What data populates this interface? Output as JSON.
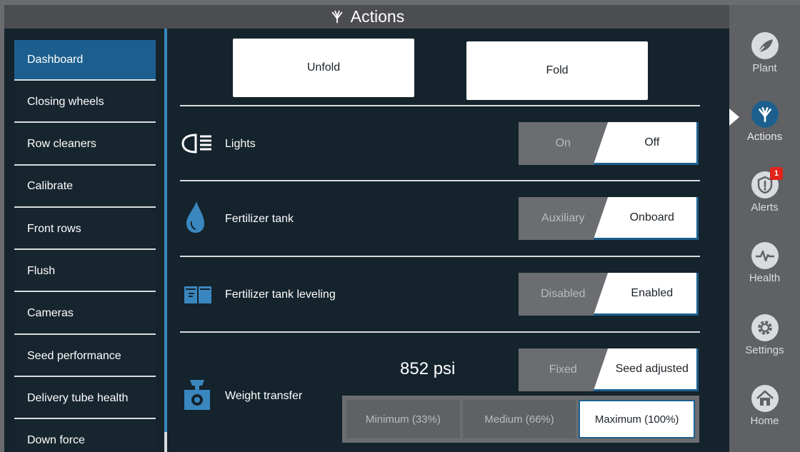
{
  "header": {
    "title": "Actions",
    "icon": "actions-icon"
  },
  "menu": {
    "items": [
      {
        "label": "Dashboard",
        "active": true
      },
      {
        "label": "Closing wheels"
      },
      {
        "label": "Row cleaners"
      },
      {
        "label": "Calibrate"
      },
      {
        "label": "Front rows"
      },
      {
        "label": "Flush"
      },
      {
        "label": "Cameras"
      },
      {
        "label": "Seed performance"
      },
      {
        "label": "Delivery tube health"
      },
      {
        "label": "Down force"
      }
    ]
  },
  "actions": {
    "unfold_label": "Unfold",
    "fold_label": "Fold"
  },
  "rows": {
    "lights": {
      "label": "Lights",
      "icon": "headlight-icon",
      "off_option": "On",
      "on_option": "Off"
    },
    "fert_tank": {
      "label": "Fertilizer tank",
      "icon": "droplet-icon",
      "off_option": "Auxiliary",
      "on_option": "Onboard"
    },
    "fert_leveling": {
      "label": "Fertilizer tank leveling",
      "icon": "tank-leveling-icon",
      "off_option": "Disabled",
      "on_option": "Enabled"
    },
    "weight_transfer": {
      "label": "Weight transfer",
      "icon": "scale-icon",
      "pressure": "852 psi",
      "off_option": "Fixed",
      "on_option": "Seed adjusted",
      "levels": [
        "Minimum (33%)",
        "Medium (66%)",
        "Maximum (100%)"
      ],
      "selected_level": "Maximum (100%)"
    }
  },
  "nav": {
    "plant": {
      "label": "Plant",
      "icon": "plant-icon"
    },
    "actions": {
      "label": "Actions",
      "icon": "actions-icon",
      "active": true
    },
    "alerts": {
      "label": "Alerts",
      "icon": "shield-alert-icon",
      "badge": "1"
    },
    "health": {
      "label": "Health",
      "icon": "heartbeat-icon"
    },
    "settings": {
      "label": "Settings",
      "icon": "gear-icon"
    },
    "home": {
      "label": "Home",
      "icon": "home-icon"
    }
  },
  "colors": {
    "accent": "#1c5f8e",
    "background": "#14232c",
    "alert": "#e2231a",
    "icon_blue": "#3a87c0"
  }
}
